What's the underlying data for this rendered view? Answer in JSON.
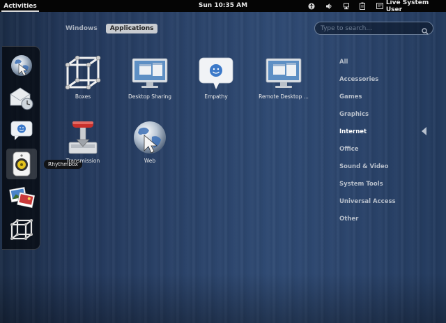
{
  "topbar": {
    "activities_label": "Activities",
    "clock": "Sun 10:35 AM",
    "user_label": "Live System User",
    "tray_icons": [
      "accessibility-icon",
      "volume-icon",
      "network-icon",
      "clipboard-icon",
      "user-status-icon"
    ]
  },
  "views": {
    "windows": "Windows",
    "applications": "Applications",
    "active": "Applications"
  },
  "search": {
    "placeholder": "Type to search...",
    "value": ""
  },
  "dash": {
    "items": [
      "web-browser-icon",
      "mail-clock-icon",
      "empathy-chat-icon",
      "rhythmbox-speaker-icon",
      "photos-icon",
      "boxes-icon"
    ],
    "selected_index": 3,
    "tooltip": "Rhythmbox"
  },
  "apps": [
    {
      "label": "Boxes",
      "icon": "boxes-icon"
    },
    {
      "label": "Desktop Sharing",
      "icon": "desktop-sharing-icon"
    },
    {
      "label": "Empathy",
      "icon": "empathy-chat-icon"
    },
    {
      "label": "Remote Desktop ...",
      "icon": "remote-desktop-icon"
    },
    {
      "label": "Transmission",
      "icon": "transmission-icon"
    },
    {
      "label": "Web",
      "icon": "web-globe-icon"
    }
  ],
  "categories": {
    "items": [
      "All",
      "Accessories",
      "Games",
      "Graphics",
      "Internet",
      "Office",
      "Sound & Video",
      "System Tools",
      "Universal Access",
      "Other"
    ],
    "active": "Internet"
  }
}
